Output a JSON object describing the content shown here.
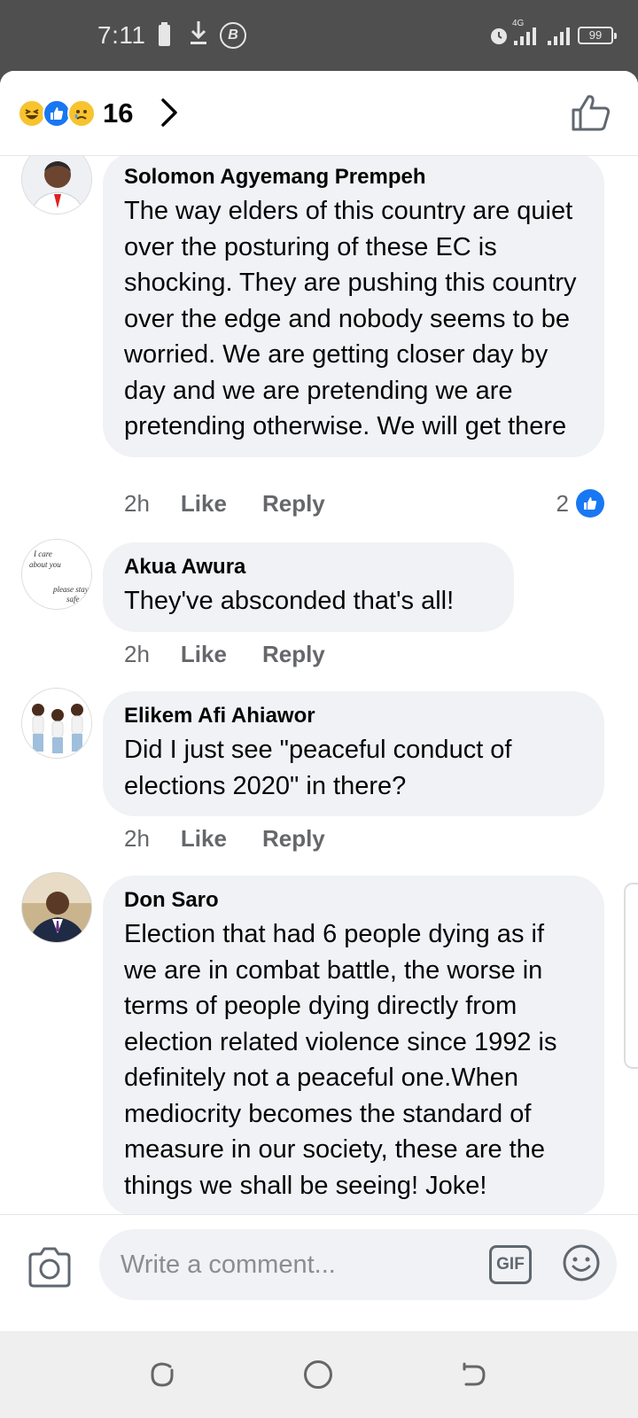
{
  "status_bar": {
    "time": "7:11",
    "battery_level": "99",
    "network": "4G",
    "icons": [
      "battery-icon",
      "download-icon",
      "b-badge-icon",
      "alarm-icon",
      "signal-icon",
      "signal-icon",
      "battery-icon"
    ]
  },
  "header": {
    "reaction_icons": [
      "haha-reaction-icon",
      "like-reaction-icon",
      "sad-reaction-icon"
    ],
    "reaction_count": "16"
  },
  "comments": [
    {
      "author": "Solomon Agyemang Prempeh",
      "text": "The way elders of this country are quiet over the posturing of these EC is shocking. They are pushing this country over the edge and nobody seems to be worried. We are getting closer day by day and we are pretending we are pretending otherwise. We will get there",
      "time": "2h",
      "like_label": "Like",
      "reply_label": "Reply",
      "reaction_count": "2"
    },
    {
      "author": "Akua Awura",
      "text": "They've absconded that's all!",
      "time": "2h",
      "like_label": "Like",
      "reply_label": "Reply",
      "avatar_text": [
        "I care",
        "about you",
        "please stay",
        "safe"
      ]
    },
    {
      "author": "Elikem Afi Ahiawor",
      "text": "Did I just see \"peaceful conduct of elections 2020\" in there?",
      "time": "2h",
      "like_label": "Like",
      "reply_label": "Reply"
    },
    {
      "author": "Don Saro",
      "text": "Election that had 6 people dying as if we are in combat battle, the worse in terms of people dying  directly from election related violence since 1992 is definitely not a peaceful one.When mediocrity becomes  the standard of measure in our society, these are the things we shall be seeing! Joke!"
    }
  ],
  "composer": {
    "placeholder": "Write a comment...",
    "gif_label": "GIF"
  },
  "colors": {
    "accent": "#1877f2",
    "bubble": "#f0f2f5",
    "secondary_text": "#65676b"
  }
}
